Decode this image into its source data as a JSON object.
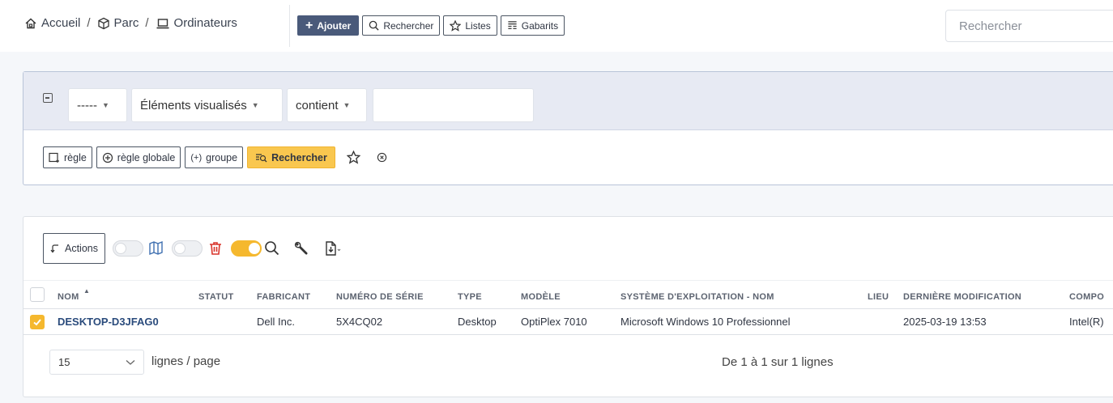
{
  "breadcrumb": [
    {
      "label": "Accueil",
      "icon": "home-icon"
    },
    {
      "label": "Parc",
      "icon": "box-icon"
    },
    {
      "label": "Ordinateurs",
      "icon": "laptop-icon"
    }
  ],
  "breadcrumb_separator": "/",
  "toolbar": {
    "add_label": "Ajouter",
    "search_label": "Rechercher",
    "lists_label": "Listes",
    "templates_label": "Gabarits"
  },
  "global_search": {
    "placeholder": "Rechercher"
  },
  "filter": {
    "field_select": "-----",
    "criteria_select": "Éléments visualisés",
    "operator_select": "contient",
    "value": "",
    "rule_label": "règle",
    "global_rule_label": "règle globale",
    "group_label": "groupe",
    "search_label": "Rechercher"
  },
  "list": {
    "actions_label": "Actions",
    "columns": [
      "NOM",
      "STATUT",
      "FABRICANT",
      "NUMÉRO DE SÉRIE",
      "TYPE",
      "MODÈLE",
      "SYSTÈME D'EXPLOITATION - NOM",
      "LIEU",
      "DERNIÈRE MODIFICATION",
      "COMPO"
    ],
    "sort_indicator": "▲",
    "rows": [
      {
        "checked": true,
        "name": "DESKTOP-D3JFAG0",
        "status": "",
        "manufacturer": "Dell Inc.",
        "serial": "5X4CQ02",
        "type": "Desktop",
        "model": "OptiPlex 7010",
        "os": "Microsoft Windows 10 Professionnel",
        "location": "",
        "modified": "2025-03-19 13:53",
        "component": "Intel(R)"
      }
    ],
    "page_size": "15",
    "page_size_label": "lignes / page",
    "count_text": "De 1 à 1 sur 1 lignes"
  },
  "colors": {
    "primary": "#4a5a7a",
    "accent": "#f5b82e",
    "filter_bg": "#e7eaf3",
    "link": "#2a4b7c",
    "trash": "#d9342b"
  }
}
